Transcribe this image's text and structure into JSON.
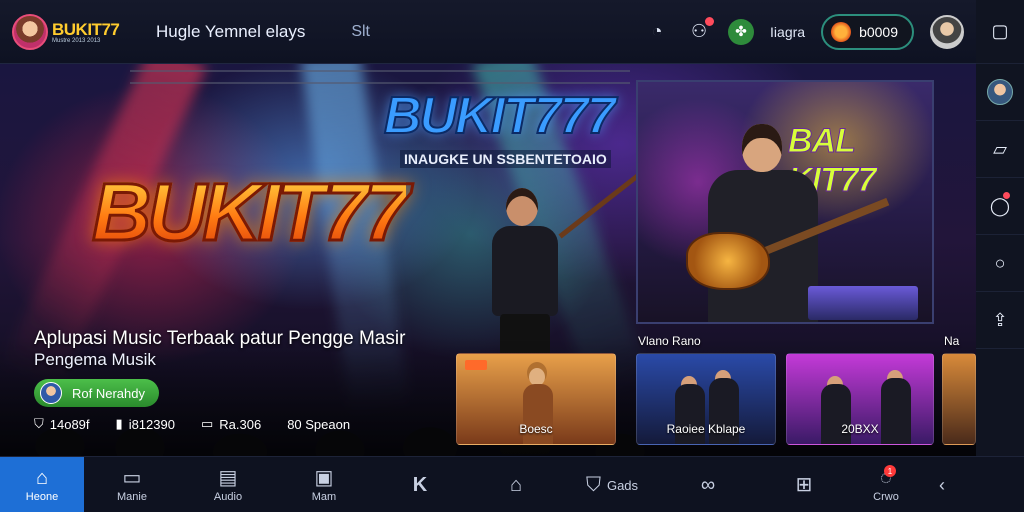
{
  "topbar": {
    "logo_text": "BUKIT77",
    "logo_sub": "Mustre 2013 2013",
    "title": "Hugle Yemnel elays",
    "search": "Slt",
    "label": "Iiagra",
    "coins": "b0009",
    "icons": [
      "clock-icon",
      "gamepad-icon",
      "clover-icon"
    ]
  },
  "rail": {
    "icons": [
      "square-icon",
      "profile-avatar",
      "chat-icon",
      "notification-icon",
      "search-icon",
      "share-icon"
    ]
  },
  "hero": {
    "brand_top": "BUKIT777",
    "brand_sub": "INAUGKE UN SSBENTETOAIO",
    "brand_big": "BUKIT77",
    "feature_logo": "BAL KIT77",
    "headline": "Aplupasi Music Terbaak patur Pengge Masir",
    "subline": "Pengema Musik",
    "cta": "Rof Nerahdy",
    "stats": [
      {
        "icon": "shield-icon",
        "value": "14o89f"
      },
      {
        "icon": "bookmark-icon",
        "value": "i812390"
      },
      {
        "icon": "chat-icon",
        "value": "Ra.306"
      },
      {
        "icon": "",
        "value": "80 Speaon"
      }
    ],
    "row_label_1": "Vlano Rano",
    "row_label_2": "Na",
    "thumbs": [
      {
        "caption": "Boesc"
      },
      {
        "caption": "Raoiee Kblape"
      },
      {
        "caption": "20BXX"
      },
      {
        "caption": ""
      }
    ]
  },
  "nav": {
    "items": [
      {
        "icon": "home-icon",
        "label": "Heone",
        "active": true
      },
      {
        "icon": "video-icon",
        "label": "Manie"
      },
      {
        "icon": "music-icon",
        "label": "Audio"
      },
      {
        "icon": "folder-icon",
        "label": "Mam"
      },
      {
        "icon": "k-icon",
        "label": ""
      },
      {
        "icon": "house-icon",
        "label": ""
      },
      {
        "icon": "shield-icon",
        "label": "Gads"
      },
      {
        "icon": "link-icon",
        "label": ""
      },
      {
        "icon": "grid-icon",
        "label": ""
      },
      {
        "icon": "chat-icon",
        "label": "Crwo"
      }
    ],
    "notification_count": "1"
  }
}
